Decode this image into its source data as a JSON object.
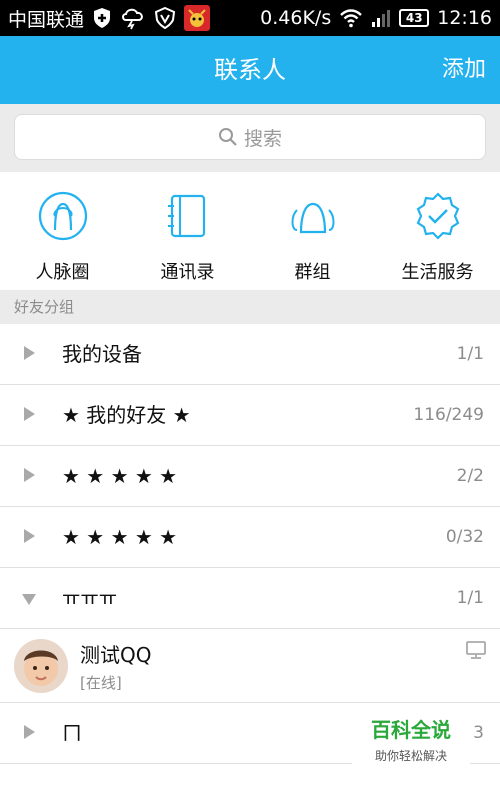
{
  "status_bar": {
    "carrier": "中国联通",
    "speed": "0.46K/s",
    "battery": "43",
    "time": "12:16",
    "icons": [
      "shield-plus-icon",
      "thunderstorm-icon",
      "security-v-icon",
      "app-mascot-icon",
      "wifi-icon",
      "signal-icon",
      "battery-icon"
    ]
  },
  "header": {
    "title": "联系人",
    "add_label": "添加",
    "color": "#23b2ee"
  },
  "search": {
    "placeholder": "搜索"
  },
  "shortcuts": [
    {
      "label": "人脉圈",
      "icon": "contacts-circle-icon"
    },
    {
      "label": "通讯录",
      "icon": "address-book-icon"
    },
    {
      "label": "群组",
      "icon": "group-icon"
    },
    {
      "label": "生活服务",
      "icon": "service-badge-icon"
    }
  ],
  "section_title": "好友分组",
  "groups": [
    {
      "name": "我的设备",
      "count": "1/1",
      "expanded": false
    },
    {
      "name": "★ 我的好友 ★",
      "count": "116/249",
      "expanded": false
    },
    {
      "name": "★ ★ ★ ★ ★",
      "count": "2/2",
      "expanded": false
    },
    {
      "name": "★ ★ ★ ★ ★",
      "count": "0/32",
      "expanded": false
    },
    {
      "name": "ㅠㅠㅠ",
      "count": "1/1",
      "expanded": true
    },
    {
      "name": "ㄇ",
      "count": "3",
      "expanded": false
    }
  ],
  "friend": {
    "name": "测试QQ",
    "status": "[在线]",
    "device_icon": "computer-icon"
  },
  "watermark": {
    "title": "百科全说",
    "subtitle": "助你轻松解决"
  }
}
